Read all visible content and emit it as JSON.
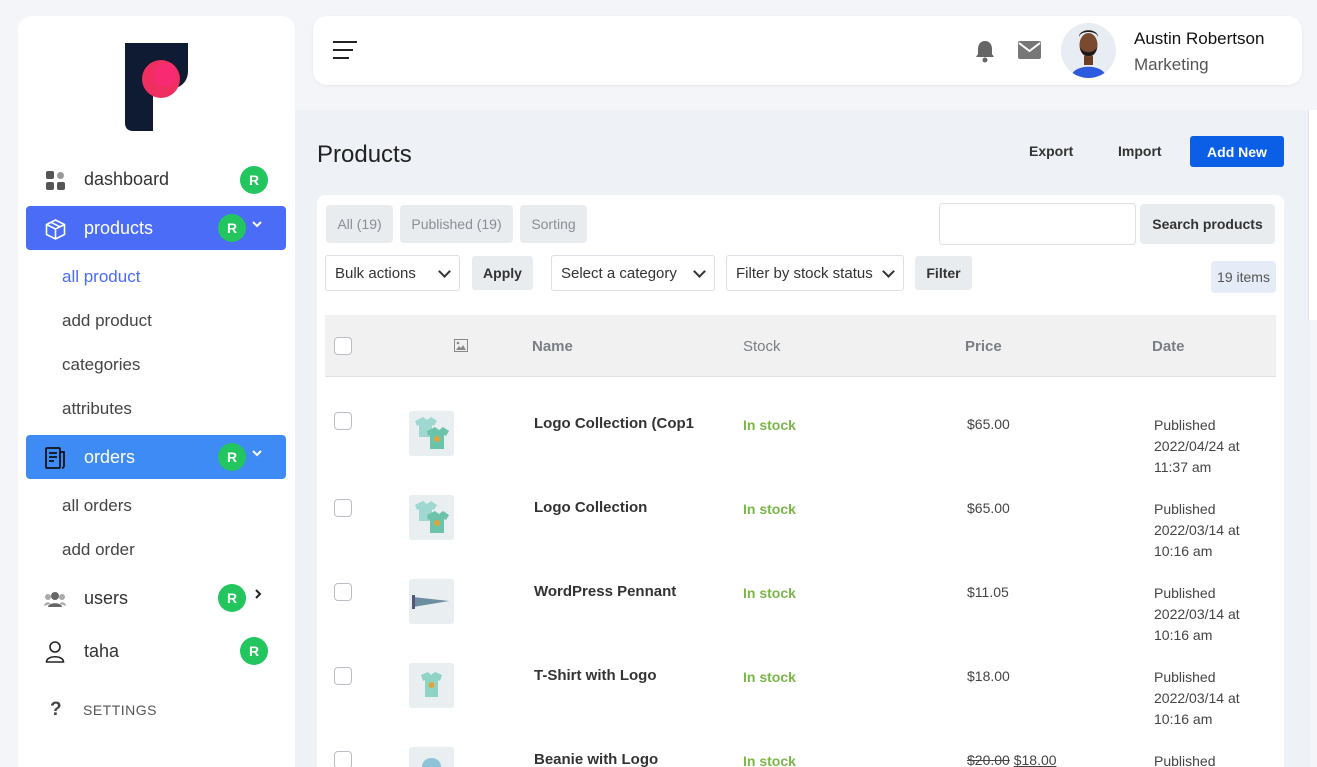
{
  "sidebar": {
    "items": [
      {
        "label": "dashboard",
        "badge": "R",
        "icon": "grid-icon"
      },
      {
        "label": "products",
        "badge": "R",
        "icon": "box-icon"
      },
      {
        "label": "orders",
        "badge": "R",
        "icon": "receipt-icon"
      },
      {
        "label": "users",
        "badge": "R",
        "icon": "users-icon"
      },
      {
        "label": "taha",
        "badge": "R",
        "icon": "person-icon"
      }
    ],
    "products_sub": [
      "all product",
      "add product",
      "categories",
      "attributes"
    ],
    "orders_sub": [
      "all orders",
      "add order"
    ],
    "settings": {
      "label": "SETTINGS",
      "icon": "question-icon"
    }
  },
  "header": {
    "user_name": "Austin Robertson",
    "user_role": "Marketing"
  },
  "page": {
    "title": "Products",
    "export": "Export",
    "import": "Import",
    "add_new": "Add New"
  },
  "filters": {
    "tabs": [
      "All (19)",
      "Published (19)",
      "Sorting"
    ],
    "search_button": "Search products",
    "search_value": "",
    "bulk_actions": "Bulk actions",
    "apply": "Apply",
    "category": "Select a category",
    "stock_status": "Filter by stock status",
    "filter": "Filter",
    "items_count": "19 items"
  },
  "table": {
    "headers": {
      "name": "Name",
      "stock": "Stock",
      "price": "Price",
      "date": "Date"
    },
    "rows": [
      {
        "name": "Logo Collection (Cop1",
        "stock": "In stock",
        "price": "$65.00",
        "old_price": "",
        "status": "Published",
        "date": "2022/04/24 at",
        "time": "11:37 am"
      },
      {
        "name": "Logo Collection",
        "stock": "In stock",
        "price": "$65.00",
        "old_price": "",
        "status": "Published",
        "date": "2022/03/14 at",
        "time": "10:16 am"
      },
      {
        "name": "WordPress Pennant",
        "stock": "In stock",
        "price": "$11.05",
        "old_price": "",
        "status": "Published",
        "date": "2022/03/14 at",
        "time": "10:16 am"
      },
      {
        "name": "T-Shirt with Logo",
        "stock": "In stock",
        "price": "$18.00",
        "old_price": "",
        "status": "Published",
        "date": "2022/03/14 at",
        "time": "10:16 am"
      },
      {
        "name": "Beanie with Logo",
        "stock": "In stock",
        "price": "$18.00",
        "old_price": "$20.00",
        "status": "Published",
        "date": "",
        "time": ""
      }
    ]
  },
  "colors": {
    "accent": "#4a6cf7",
    "orders_active": "#3e8bf5",
    "badge": "#22c55e",
    "add_new": "#0b5fe6",
    "in_stock": "#7ab648"
  }
}
